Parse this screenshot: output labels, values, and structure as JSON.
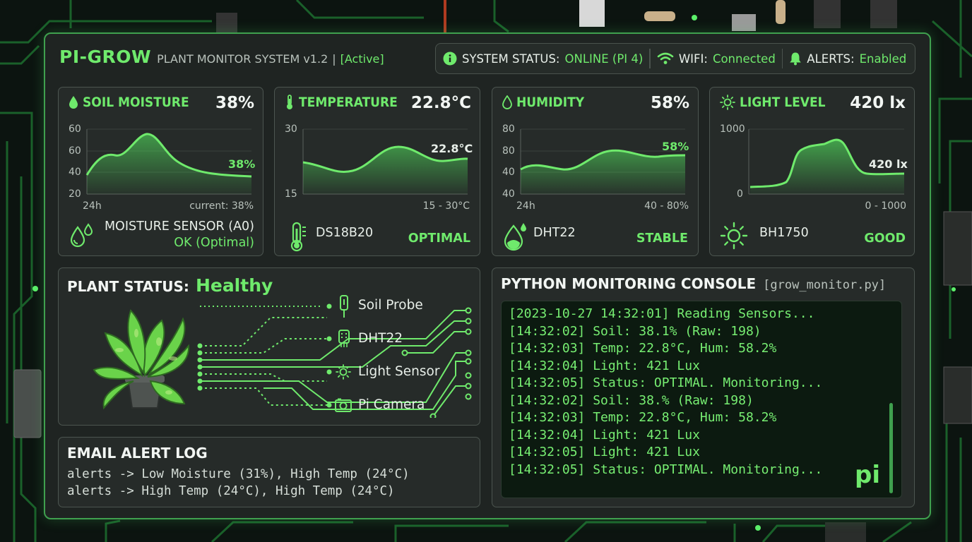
{
  "header": {
    "brand": "PI-GROW",
    "subtitle": "PLANT MONITOR SYSTEM v1.2",
    "separator": "|",
    "mode": "[Active]"
  },
  "status_bar": {
    "system_label": "SYSTEM STATUS:",
    "system_value": "ONLINE (PI 4)",
    "wifi_label": "WIFI:",
    "wifi_value": "Connected",
    "alerts_label": "ALERTS:",
    "alerts_value": "Enabled"
  },
  "sensors": [
    {
      "title": "SOIL MOISTURE",
      "value": "38%",
      "icon": "water-drop-icon",
      "y_ticks": [
        "60",
        "60",
        "40",
        "20"
      ],
      "x_left": "24h",
      "x_right": "current: 38%",
      "current_label": "38%",
      "footer_icon": "water-drops-icon",
      "footer_name": "MOISTURE SENSOR (A0)",
      "footer_state": "OK (Optimal)"
    },
    {
      "title": "TEMPERATURE",
      "value": "22.8°C",
      "icon": "thermometer-icon",
      "y_ticks": [
        "30",
        "15"
      ],
      "x_left": "",
      "x_right": "15 - 30°C",
      "current_label": "22.8°C",
      "footer_icon": "thermometer-icon",
      "footer_name": "DS18B20",
      "footer_state": "OPTIMAL"
    },
    {
      "title": "HUMIDITY",
      "value": "58%",
      "icon": "humidity-drop-icon",
      "y_ticks": [
        "80",
        "80",
        "40",
        "40"
      ],
      "x_left": "24h",
      "x_right": "40 - 80%",
      "current_label": "58%",
      "footer_icon": "humidity-sensor-icon",
      "footer_name": "DHT22",
      "footer_state": "STABLE"
    },
    {
      "title": "LIGHT LEVEL",
      "value": "420 lx",
      "icon": "sun-icon",
      "y_ticks": [
        "1000",
        "0"
      ],
      "x_left": "",
      "x_right": "0 - 1000",
      "current_label": "420 lx",
      "footer_icon": "sun-icon",
      "footer_name": "BH1750",
      "footer_state": "GOOD"
    }
  ],
  "plant_status": {
    "label": "PLANT STATUS:",
    "value": "Healthy",
    "devices": [
      {
        "name": "Soil Probe",
        "icon": "probe-icon"
      },
      {
        "name": "DHT22",
        "icon": "dht22-icon"
      },
      {
        "name": "Light Sensor",
        "icon": "sun-icon"
      },
      {
        "name": "Pi Camera",
        "icon": "camera-icon"
      }
    ]
  },
  "email_log": {
    "title": "EMAIL ALERT LOG",
    "lines": [
      "alerts -> Low Moisture (31%), High Temp (24°C)",
      "alerts -> High Temp (24°C), High Temp (24°C)"
    ]
  },
  "console": {
    "title": "PYTHON MONITORING CONSOLE",
    "file": "[grow_monitor.py]",
    "lines": [
      "[2023-10-27 14:32:01] Reading Sensors...",
      "[14:32:02] Soil: 38.1% (Raw: 198)",
      "[14:32:03] Temp: 22.8°C, Hum: 58.2%",
      "[14:32:04] Light: 421 Lux",
      "[14:32:05] Status: OPTIMAL. Monitoring...",
      "[14:32:02] Soil: 38.% (Raw: 198)",
      "[14:32:03] Temp: 22.8°C, Hum: 58.2%",
      "[14:32:04] Light: 421 Lux",
      "[14:32:05] Light: 421 Lux",
      "[14:32:05] Status: OPTIMAL. Monitoring..."
    ],
    "logo": "pi"
  },
  "colors": {
    "accent": "#6fea6c",
    "panel": "#262b29",
    "frame": "#1f2422",
    "console_bg": "#0c1a10"
  }
}
